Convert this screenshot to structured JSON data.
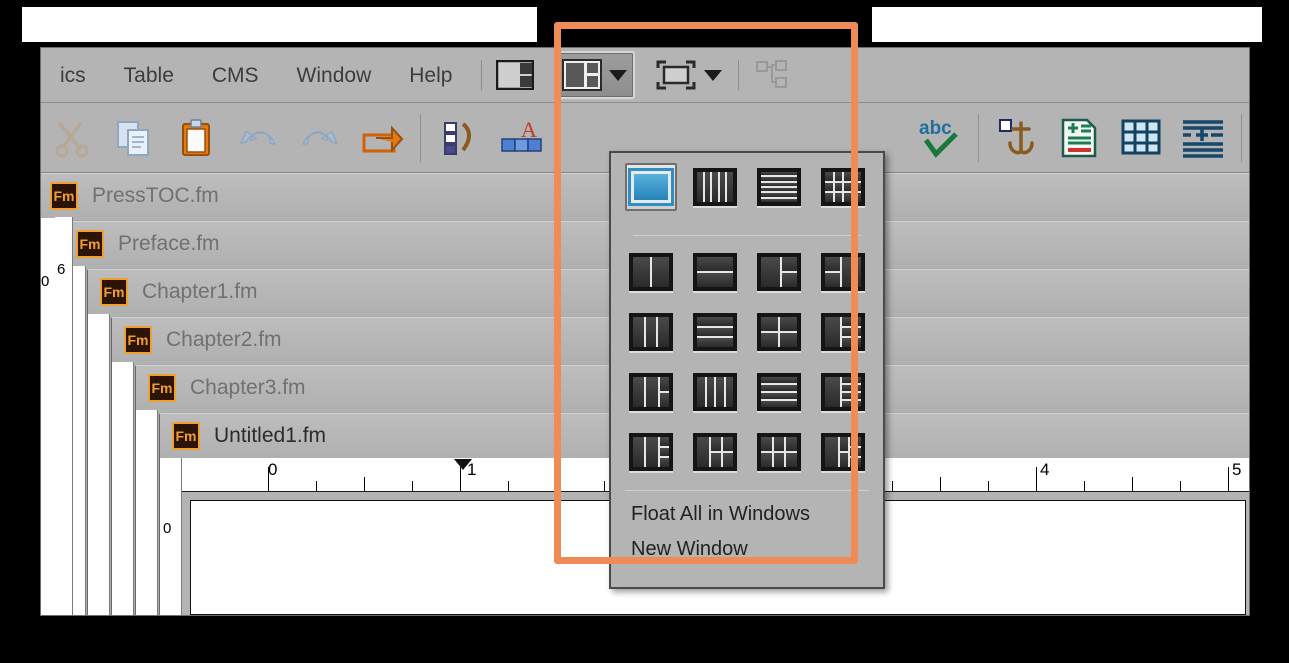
{
  "app": {
    "name": "Adobe FrameMaker",
    "accent_orange": "#ef8b55",
    "chrome_gray": "#b4b4b4"
  },
  "menubar": {
    "items": [
      {
        "label": "ics",
        "truncated": true
      },
      {
        "label": "Table"
      },
      {
        "label": "CMS"
      },
      {
        "label": "Window"
      },
      {
        "label": "Help"
      }
    ]
  },
  "toolbar": {
    "left_icons": [
      {
        "name": "cut-icon",
        "title": "Cut"
      },
      {
        "name": "copy-icon",
        "title": "Copy"
      },
      {
        "name": "paste-icon",
        "title": "Paste"
      },
      {
        "name": "undo-icon",
        "title": "Undo"
      },
      {
        "name": "redo-icon",
        "title": "Redo"
      },
      {
        "name": "insert-arrow-icon",
        "title": "Insert"
      },
      {
        "name": "numbering-icon",
        "title": "Numbering"
      },
      {
        "name": "character-format-icon",
        "title": "Character Format"
      }
    ],
    "right_icons": [
      {
        "name": "spellcheck-icon",
        "title": "Spell Check"
      },
      {
        "name": "anchor-icon",
        "title": "Anchored Frame"
      },
      {
        "name": "insert-page-icon",
        "title": "Insert Page"
      },
      {
        "name": "insert-table-icon",
        "title": "Insert Table"
      },
      {
        "name": "paragraph-format-icon",
        "title": "Paragraph Format"
      }
    ],
    "workspace_button": {
      "name": "workspace-layout-button",
      "state": "pressed"
    },
    "zoom_button": {
      "name": "float-window-button",
      "state": "normal"
    },
    "hierarchy_button": {
      "name": "hierarchy-view-button",
      "state": "disabled"
    },
    "panel_button": {
      "name": "panel-toggle-button",
      "state": "normal"
    }
  },
  "documents": [
    {
      "title": "PressTOC.fm",
      "active": false,
      "badge": "Fm"
    },
    {
      "title": "Preface.fm",
      "active": false,
      "badge": "Fm"
    },
    {
      "title": "Chapter1.fm",
      "active": false,
      "badge": "Fm"
    },
    {
      "title": "Chapter2.fm",
      "active": false,
      "badge": "Fm"
    },
    {
      "title": "Chapter3.fm",
      "active": false,
      "badge": "Fm"
    },
    {
      "title": "Untitled1.fm",
      "active": true,
      "badge": "Fm"
    }
  ],
  "ruler": {
    "horizontal_labels": [
      "0",
      "1",
      "4",
      "5"
    ],
    "vertical_labels": [
      "6",
      "0",
      "0"
    ],
    "unit": "inches"
  },
  "popup": {
    "name": "window-arrangement-menu",
    "selected_index": 0,
    "layouts": [
      {
        "id": "single",
        "label": "Single",
        "selected": true
      },
      {
        "id": "columns-5",
        "label": "5 Columns",
        "selected": false
      },
      {
        "id": "rows-6",
        "label": "6 Rows",
        "selected": false
      },
      {
        "id": "grid-4x3",
        "label": "4 x 3 Grid",
        "selected": false
      },
      {
        "id": "columns-2",
        "label": "2 Columns",
        "selected": false
      },
      {
        "id": "rows-2",
        "label": "2 Rows",
        "selected": false
      },
      {
        "id": "left-split-right",
        "label": "Left, Split Right",
        "selected": false
      },
      {
        "id": "split-left-right",
        "label": "Split Left, Right",
        "selected": false
      },
      {
        "id": "columns-3",
        "label": "3 Columns",
        "selected": false
      },
      {
        "id": "rows-3",
        "label": "3 Rows",
        "selected": false
      },
      {
        "id": "grid-2x2",
        "label": "2 x 2 Grid",
        "selected": false
      },
      {
        "id": "left-3-right",
        "label": "Left, 3 Right",
        "selected": false
      },
      {
        "id": "two-left-split",
        "label": "2 Left, Split",
        "selected": false
      },
      {
        "id": "columns-4",
        "label": "4 Columns",
        "selected": false
      },
      {
        "id": "rows-4",
        "label": "4 Rows",
        "selected": false
      },
      {
        "id": "left-4-right",
        "label": "Left, 4 Right",
        "selected": false
      },
      {
        "id": "two-left-3right",
        "label": "2 Left, 3 Right",
        "selected": false
      },
      {
        "id": "left-2x2",
        "label": "Left, 2 x 2",
        "selected": false
      },
      {
        "id": "grid-3x2",
        "label": "3 x 2 Grid",
        "selected": false
      },
      {
        "id": "mixed-grid",
        "label": "Mixed Grid",
        "selected": false
      }
    ],
    "menu_items": [
      {
        "label": "Float All in Windows"
      },
      {
        "label": "New Window"
      }
    ]
  },
  "annotation": {
    "name": "highlight-box",
    "color": "#ef8b55",
    "shape": "rectangle"
  }
}
